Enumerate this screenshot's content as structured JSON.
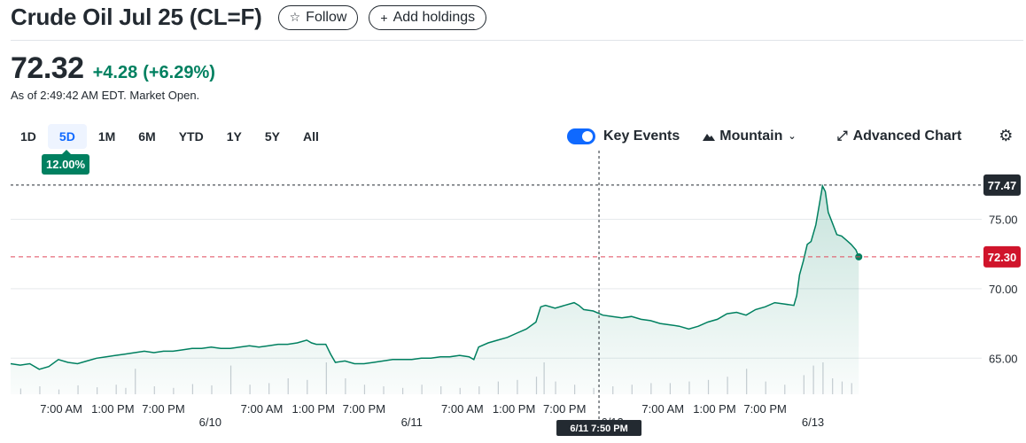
{
  "header": {
    "title": "Crude Oil Jul 25 (CL=F)",
    "follow_label": "Follow",
    "add_holdings_label": "Add holdings"
  },
  "quote": {
    "price": "72.32",
    "change": "+4.28",
    "change_pct": "(+6.29%)",
    "as_of": "As of 2:49:42 AM EDT. Market Open."
  },
  "ranges": [
    "1D",
    "5D",
    "1M",
    "6M",
    "YTD",
    "1Y",
    "5Y",
    "All"
  ],
  "active_range": "5D",
  "range_badge": "12.00%",
  "toolbar": {
    "key_events_label": "Key Events",
    "mountain_label": "Mountain",
    "advanced_label": "Advanced Chart"
  },
  "colors": {
    "up": "#008060",
    "accent": "#0f69ff",
    "prev_close": "#e0495b",
    "label_dark": "#232a31",
    "label_red": "#d0142b"
  },
  "chart_data": {
    "type": "area",
    "ylim": [
      62.4,
      78.8
    ],
    "y_ticks": [
      65.0,
      70.0,
      75.0
    ],
    "y_tick_labels": [
      "65.00",
      "70.00",
      "75.00"
    ],
    "x_range": [
      0,
      100
    ],
    "x_ticks": [
      {
        "x": 5.3,
        "label": "7:00 AM"
      },
      {
        "x": 10.7,
        "label": "1:00 PM"
      },
      {
        "x": 16.0,
        "label": "7:00 PM"
      },
      {
        "x": 20.9,
        "label": "6/10"
      },
      {
        "x": 26.3,
        "label": "7:00 AM"
      },
      {
        "x": 31.7,
        "label": "1:00 PM"
      },
      {
        "x": 37.0,
        "label": "7:00 PM"
      },
      {
        "x": 42.0,
        "label": "6/11"
      },
      {
        "x": 47.3,
        "label": "7:00 AM"
      },
      {
        "x": 52.7,
        "label": "1:00 PM"
      },
      {
        "x": 58.0,
        "label": "7:00 PM"
      },
      {
        "x": 63.0,
        "label": "6/12"
      },
      {
        "x": 68.3,
        "label": "7:00 AM"
      },
      {
        "x": 73.7,
        "label": "1:00 PM"
      },
      {
        "x": 79.0,
        "label": "7:00 PM"
      },
      {
        "x": 84.0,
        "label": "6/13"
      }
    ],
    "series": [
      {
        "values": [
          [
            0,
            64.6
          ],
          [
            1,
            64.5
          ],
          [
            2,
            64.6
          ],
          [
            3,
            64.2
          ],
          [
            4,
            64.4
          ],
          [
            5,
            64.9
          ],
          [
            6,
            64.7
          ],
          [
            7,
            64.6
          ],
          [
            8,
            64.8
          ],
          [
            9,
            65.0
          ],
          [
            10,
            65.1
          ],
          [
            11,
            65.2
          ],
          [
            12,
            65.3
          ],
          [
            13,
            65.4
          ],
          [
            14,
            65.5
          ],
          [
            15,
            65.4
          ],
          [
            16,
            65.5
          ],
          [
            17,
            65.5
          ],
          [
            18,
            65.6
          ],
          [
            19,
            65.7
          ],
          [
            20,
            65.7
          ],
          [
            21,
            65.8
          ],
          [
            22,
            65.7
          ],
          [
            23,
            65.7
          ],
          [
            24,
            65.8
          ],
          [
            25,
            65.9
          ],
          [
            26,
            65.8
          ],
          [
            27,
            65.9
          ],
          [
            28,
            66.0
          ],
          [
            29,
            66.0
          ],
          [
            30,
            66.1
          ],
          [
            31,
            66.3
          ],
          [
            31.5,
            66.1
          ],
          [
            32,
            66.0
          ],
          [
            33,
            66.0
          ],
          [
            33.5,
            65.3
          ],
          [
            34,
            64.7
          ],
          [
            35,
            64.8
          ],
          [
            36,
            64.6
          ],
          [
            37,
            64.6
          ],
          [
            38,
            64.7
          ],
          [
            39,
            64.8
          ],
          [
            40,
            64.9
          ],
          [
            41,
            64.9
          ],
          [
            42,
            64.9
          ],
          [
            43,
            65.0
          ],
          [
            44,
            65.0
          ],
          [
            45,
            65.1
          ],
          [
            46,
            65.1
          ],
          [
            47,
            65.2
          ],
          [
            48,
            65.1
          ],
          [
            48.5,
            64.9
          ],
          [
            49,
            65.8
          ],
          [
            50,
            66.1
          ],
          [
            51,
            66.3
          ],
          [
            52,
            66.5
          ],
          [
            53,
            66.8
          ],
          [
            54,
            67.1
          ],
          [
            55,
            67.6
          ],
          [
            55.5,
            68.7
          ],
          [
            56,
            68.8
          ],
          [
            57,
            68.6
          ],
          [
            58,
            68.8
          ],
          [
            59,
            69.0
          ],
          [
            59.5,
            68.8
          ],
          [
            60,
            68.5
          ],
          [
            61,
            68.4
          ],
          [
            62,
            68.1
          ],
          [
            63,
            68.0
          ],
          [
            64,
            67.9
          ],
          [
            65,
            68.0
          ],
          [
            66,
            67.8
          ],
          [
            67,
            67.7
          ],
          [
            68,
            67.5
          ],
          [
            69,
            67.4
          ],
          [
            70,
            67.3
          ],
          [
            71,
            67.1
          ],
          [
            72,
            67.3
          ],
          [
            73,
            67.6
          ],
          [
            74,
            67.8
          ],
          [
            75,
            68.2
          ],
          [
            76,
            68.3
          ],
          [
            77,
            68.1
          ],
          [
            78,
            68.5
          ],
          [
            79,
            68.7
          ],
          [
            80,
            69.0
          ],
          [
            81,
            68.9
          ],
          [
            82,
            68.8
          ],
          [
            82.3,
            69.5
          ],
          [
            82.6,
            71.0
          ],
          [
            83,
            72.0
          ],
          [
            83.4,
            73.2
          ],
          [
            83.8,
            73.4
          ],
          [
            84.3,
            74.6
          ],
          [
            84.7,
            76.2
          ],
          [
            85,
            77.4
          ],
          [
            85.3,
            77.0
          ],
          [
            85.6,
            75.5
          ],
          [
            86,
            74.8
          ],
          [
            86.5,
            73.9
          ],
          [
            87,
            73.8
          ],
          [
            87.5,
            73.5
          ],
          [
            88,
            73.2
          ],
          [
            88.5,
            72.8
          ],
          [
            88.8,
            72.3
          ]
        ]
      }
    ],
    "volume": [
      [
        1,
        0.18
      ],
      [
        3,
        0.25
      ],
      [
        5,
        0.15
      ],
      [
        7,
        0.28
      ],
      [
        9,
        0.22
      ],
      [
        11,
        0.3
      ],
      [
        12,
        0.2
      ],
      [
        13,
        0.8
      ],
      [
        15,
        0.25
      ],
      [
        17,
        0.2
      ],
      [
        19,
        0.32
      ],
      [
        21,
        0.28
      ],
      [
        23,
        0.9
      ],
      [
        25,
        0.3
      ],
      [
        27,
        0.35
      ],
      [
        29,
        0.5
      ],
      [
        31,
        0.45
      ],
      [
        33,
        1.0
      ],
      [
        35,
        0.5
      ],
      [
        37,
        0.3
      ],
      [
        39,
        0.25
      ],
      [
        41,
        0.2
      ],
      [
        43,
        0.3
      ],
      [
        45,
        0.25
      ],
      [
        47,
        0.2
      ],
      [
        49,
        0.25
      ],
      [
        51,
        0.4
      ],
      [
        53,
        0.45
      ],
      [
        55,
        0.55
      ],
      [
        55.8,
        1.0
      ],
      [
        57,
        0.4
      ],
      [
        59,
        0.3
      ],
      [
        61,
        0.2
      ],
      [
        63,
        0.25
      ],
      [
        65,
        0.3
      ],
      [
        67,
        0.35
      ],
      [
        69,
        0.35
      ],
      [
        71,
        0.4
      ],
      [
        73,
        0.45
      ],
      [
        75,
        0.55
      ],
      [
        77,
        0.8
      ],
      [
        79,
        0.4
      ],
      [
        81,
        0.3
      ],
      [
        83,
        0.6
      ],
      [
        84,
        0.9
      ],
      [
        85,
        1.0
      ],
      [
        86,
        0.5
      ],
      [
        87,
        0.4
      ],
      [
        88,
        0.35
      ]
    ],
    "prev_close": 72.3,
    "prev_close_label": "72.30",
    "high_label": "77.47",
    "high_value": 77.47,
    "crosshair_x": 61.6,
    "crosshair_label": "6/11 7:50 PM"
  }
}
